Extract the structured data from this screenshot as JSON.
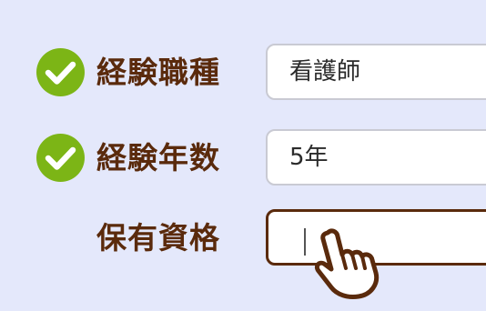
{
  "colors": {
    "background": "#e4e8fb",
    "check_fill": "#7cb516",
    "label_text": "#5a2a0c",
    "field_border": "#c9cad3",
    "field_active_border": "#5a2a0c"
  },
  "form": {
    "rows": [
      {
        "label": "経験職種",
        "value": "看護師",
        "completed": true,
        "icon": "check-icon"
      },
      {
        "label": "経験年数",
        "value": "5年",
        "completed": true,
        "icon": "check-icon"
      },
      {
        "label": "保有資格",
        "value": "",
        "completed": false,
        "focused": true
      }
    ]
  },
  "cursor": {
    "icon": "hand-pointer-icon"
  }
}
